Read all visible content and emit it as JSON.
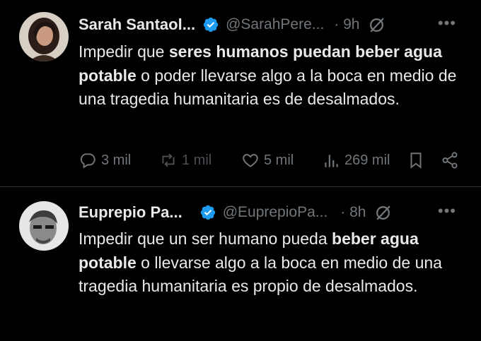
{
  "tweets": [
    {
      "author_name": "Sarah Santaol...",
      "handle": "@SarahPere...",
      "time": "· 9h",
      "text_segments": [
        {
          "t": "Impedir que ",
          "b": false
        },
        {
          "t": "seres humanos puedan beber agua potable",
          "b": true
        },
        {
          "t": " o poder llevarse algo a la boca en medio de una tragedia humanitaria es de desalmados.",
          "b": false
        }
      ],
      "replies": "3 mil",
      "reposts": "1 mil",
      "likes": "5 mil",
      "views": "269 mil"
    },
    {
      "author_name": "Euprepio Pa...",
      "handle": "@EuprepioPa...",
      "time": "· 8h",
      "text_segments": [
        {
          "t": "Impedir que un ser humano pueda ",
          "b": false
        },
        {
          "t": "beber agua potable",
          "b": true
        },
        {
          "t": " o llevarse algo a la boca en medio de una tragedia humanitaria es propio de desalmados.",
          "b": false
        }
      ]
    }
  ],
  "more_label": "•••",
  "colors": {
    "verified": "#1d9bf0",
    "muted": "#71767b",
    "text": "#e7e9ea",
    "bg": "#000000"
  },
  "icons": [
    "reply-icon",
    "repost-icon",
    "like-icon",
    "views-icon",
    "bookmark-icon",
    "share-icon",
    "verified-badge-icon",
    "grok-icon",
    "more-icon"
  ]
}
